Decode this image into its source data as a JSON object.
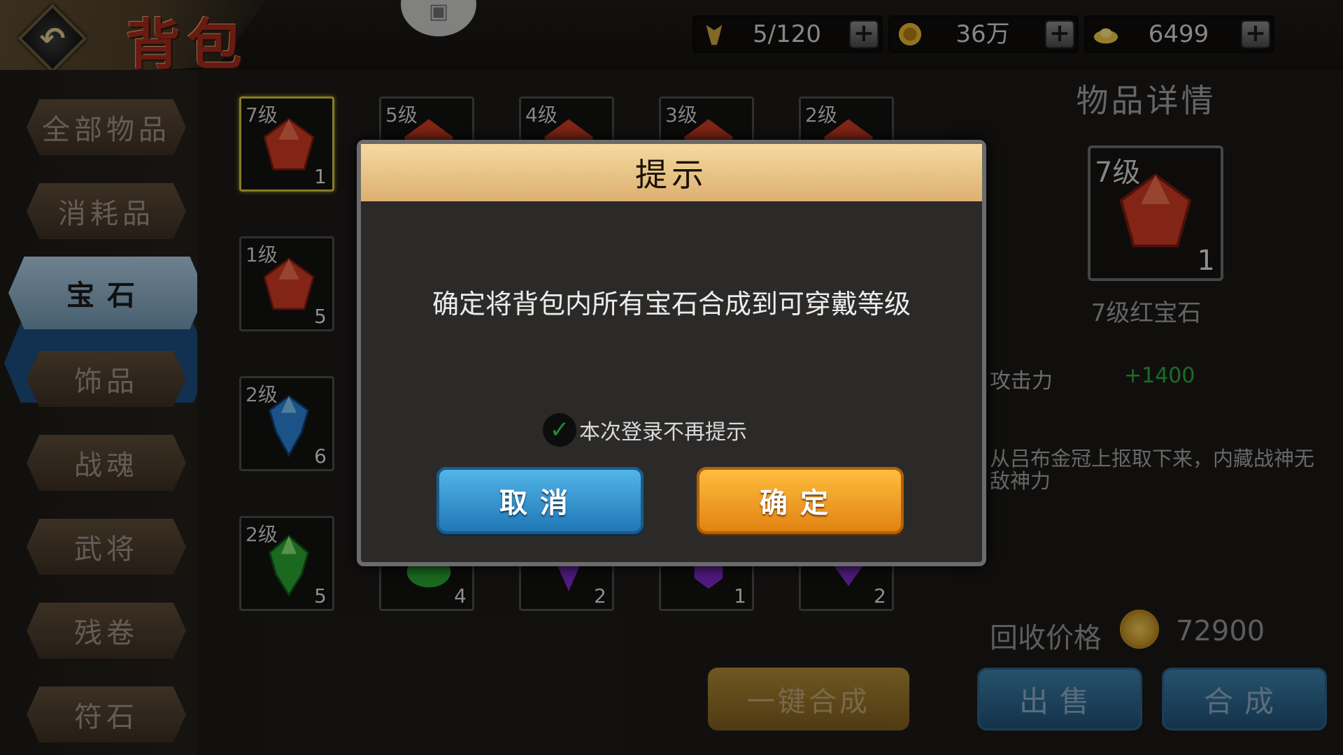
{
  "header": {
    "title": "背包",
    "back_icon": "back-arrow-icon",
    "camera_icon": "camera-icon",
    "resources": [
      {
        "icon": "bag-capacity-icon",
        "value": "5/120"
      },
      {
        "icon": "coin-icon",
        "value": "36万"
      },
      {
        "icon": "gold-ingot-icon",
        "value": "6499"
      }
    ],
    "plus_label": "+"
  },
  "sidebar": {
    "tabs": [
      {
        "label": "全部物品"
      },
      {
        "label": "消耗品"
      },
      {
        "label": "宝石",
        "active": true
      },
      {
        "label": "饰品"
      },
      {
        "label": "战魂"
      },
      {
        "label": "武将"
      },
      {
        "label": "残卷"
      },
      {
        "label": "符石"
      }
    ]
  },
  "inventory": {
    "items": [
      {
        "level": "7级",
        "count": "1",
        "gem": "red"
      },
      {
        "level": "5级",
        "count": "",
        "gem": "red"
      },
      {
        "level": "4级",
        "count": "",
        "gem": "red"
      },
      {
        "level": "3级",
        "count": "",
        "gem": "red"
      },
      {
        "level": "2级",
        "count": "",
        "gem": "red"
      },
      {
        "level": "1级",
        "count": "5",
        "gem": "red"
      },
      {
        "level": "2级",
        "count": "6",
        "gem": "blue"
      },
      {
        "level": "2级",
        "count": "5",
        "gem": "green"
      },
      {
        "level": "",
        "count": "4",
        "gem": "green"
      },
      {
        "level": "",
        "count": "2",
        "gem": "purple"
      },
      {
        "level": "",
        "count": "1",
        "gem": "purple"
      },
      {
        "level": "",
        "count": "2",
        "gem": "purple"
      }
    ],
    "merge_all_label": "一键合成"
  },
  "detail": {
    "title": "物品详情",
    "slot_level": "7级",
    "slot_count": "1",
    "item_name": "7级红宝石",
    "stat_name": "攻击力",
    "stat_value": "+1400",
    "description": "从吕布金冠上抠取下来，内藏战神无敌神力",
    "price_label": "回收价格",
    "price_value": "72900",
    "sell_label": "出售",
    "merge_label": "合成"
  },
  "dialog": {
    "title": "提示",
    "message": "确定将背包内所有宝石合成到可穿戴等级",
    "checkbox_label": "本次登录不再提示",
    "checkbox_checked": true,
    "cancel_label": "取消",
    "confirm_label": "确定"
  },
  "colors": {
    "red_gem": "#c83a22",
    "blue_gem": "#2a7fd0",
    "green_gem": "#2aa030",
    "purple_gem": "#7a2ac0",
    "stat_green": "#2aa83a"
  }
}
